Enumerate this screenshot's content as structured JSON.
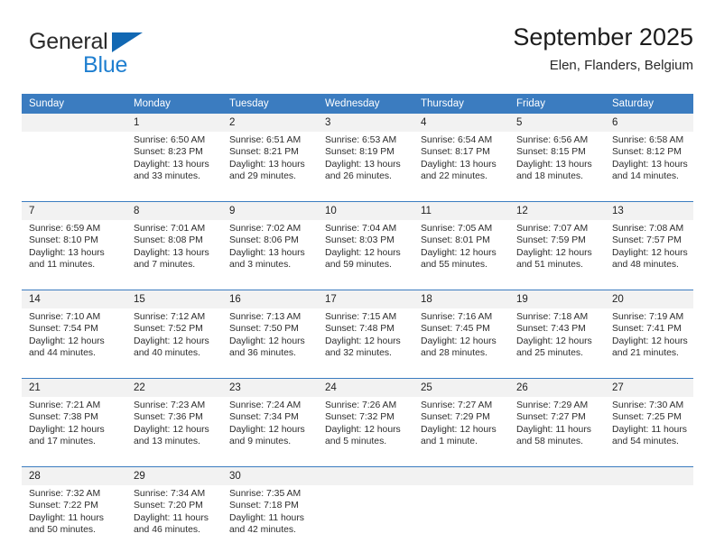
{
  "logo": {
    "word1": "General",
    "word2": "Blue",
    "triangle_color": "#1268b3",
    "blue_text_color": "#1f7fd0"
  },
  "header": {
    "title": "September 2025",
    "subtitle": "Elen, Flanders, Belgium",
    "header_bg": "#3b7cc0",
    "daynum_bg": "#f2f2f2"
  },
  "weekday_headers": [
    "Sunday",
    "Monday",
    "Tuesday",
    "Wednesday",
    "Thursday",
    "Friday",
    "Saturday"
  ],
  "weeks": [
    {
      "days": [
        {
          "num": "",
          "sunrise": "",
          "sunset": "",
          "daylight1": "",
          "daylight2": ""
        },
        {
          "num": "1",
          "sunrise": "Sunrise: 6:50 AM",
          "sunset": "Sunset: 8:23 PM",
          "daylight1": "Daylight: 13 hours",
          "daylight2": "and 33 minutes."
        },
        {
          "num": "2",
          "sunrise": "Sunrise: 6:51 AM",
          "sunset": "Sunset: 8:21 PM",
          "daylight1": "Daylight: 13 hours",
          "daylight2": "and 29 minutes."
        },
        {
          "num": "3",
          "sunrise": "Sunrise: 6:53 AM",
          "sunset": "Sunset: 8:19 PM",
          "daylight1": "Daylight: 13 hours",
          "daylight2": "and 26 minutes."
        },
        {
          "num": "4",
          "sunrise": "Sunrise: 6:54 AM",
          "sunset": "Sunset: 8:17 PM",
          "daylight1": "Daylight: 13 hours",
          "daylight2": "and 22 minutes."
        },
        {
          "num": "5",
          "sunrise": "Sunrise: 6:56 AM",
          "sunset": "Sunset: 8:15 PM",
          "daylight1": "Daylight: 13 hours",
          "daylight2": "and 18 minutes."
        },
        {
          "num": "6",
          "sunrise": "Sunrise: 6:58 AM",
          "sunset": "Sunset: 8:12 PM",
          "daylight1": "Daylight: 13 hours",
          "daylight2": "and 14 minutes."
        }
      ]
    },
    {
      "days": [
        {
          "num": "7",
          "sunrise": "Sunrise: 6:59 AM",
          "sunset": "Sunset: 8:10 PM",
          "daylight1": "Daylight: 13 hours",
          "daylight2": "and 11 minutes."
        },
        {
          "num": "8",
          "sunrise": "Sunrise: 7:01 AM",
          "sunset": "Sunset: 8:08 PM",
          "daylight1": "Daylight: 13 hours",
          "daylight2": "and 7 minutes."
        },
        {
          "num": "9",
          "sunrise": "Sunrise: 7:02 AM",
          "sunset": "Sunset: 8:06 PM",
          "daylight1": "Daylight: 13 hours",
          "daylight2": "and 3 minutes."
        },
        {
          "num": "10",
          "sunrise": "Sunrise: 7:04 AM",
          "sunset": "Sunset: 8:03 PM",
          "daylight1": "Daylight: 12 hours",
          "daylight2": "and 59 minutes."
        },
        {
          "num": "11",
          "sunrise": "Sunrise: 7:05 AM",
          "sunset": "Sunset: 8:01 PM",
          "daylight1": "Daylight: 12 hours",
          "daylight2": "and 55 minutes."
        },
        {
          "num": "12",
          "sunrise": "Sunrise: 7:07 AM",
          "sunset": "Sunset: 7:59 PM",
          "daylight1": "Daylight: 12 hours",
          "daylight2": "and 51 minutes."
        },
        {
          "num": "13",
          "sunrise": "Sunrise: 7:08 AM",
          "sunset": "Sunset: 7:57 PM",
          "daylight1": "Daylight: 12 hours",
          "daylight2": "and 48 minutes."
        }
      ]
    },
    {
      "days": [
        {
          "num": "14",
          "sunrise": "Sunrise: 7:10 AM",
          "sunset": "Sunset: 7:54 PM",
          "daylight1": "Daylight: 12 hours",
          "daylight2": "and 44 minutes."
        },
        {
          "num": "15",
          "sunrise": "Sunrise: 7:12 AM",
          "sunset": "Sunset: 7:52 PM",
          "daylight1": "Daylight: 12 hours",
          "daylight2": "and 40 minutes."
        },
        {
          "num": "16",
          "sunrise": "Sunrise: 7:13 AM",
          "sunset": "Sunset: 7:50 PM",
          "daylight1": "Daylight: 12 hours",
          "daylight2": "and 36 minutes."
        },
        {
          "num": "17",
          "sunrise": "Sunrise: 7:15 AM",
          "sunset": "Sunset: 7:48 PM",
          "daylight1": "Daylight: 12 hours",
          "daylight2": "and 32 minutes."
        },
        {
          "num": "18",
          "sunrise": "Sunrise: 7:16 AM",
          "sunset": "Sunset: 7:45 PM",
          "daylight1": "Daylight: 12 hours",
          "daylight2": "and 28 minutes."
        },
        {
          "num": "19",
          "sunrise": "Sunrise: 7:18 AM",
          "sunset": "Sunset: 7:43 PM",
          "daylight1": "Daylight: 12 hours",
          "daylight2": "and 25 minutes."
        },
        {
          "num": "20",
          "sunrise": "Sunrise: 7:19 AM",
          "sunset": "Sunset: 7:41 PM",
          "daylight1": "Daylight: 12 hours",
          "daylight2": "and 21 minutes."
        }
      ]
    },
    {
      "days": [
        {
          "num": "21",
          "sunrise": "Sunrise: 7:21 AM",
          "sunset": "Sunset: 7:38 PM",
          "daylight1": "Daylight: 12 hours",
          "daylight2": "and 17 minutes."
        },
        {
          "num": "22",
          "sunrise": "Sunrise: 7:23 AM",
          "sunset": "Sunset: 7:36 PM",
          "daylight1": "Daylight: 12 hours",
          "daylight2": "and 13 minutes."
        },
        {
          "num": "23",
          "sunrise": "Sunrise: 7:24 AM",
          "sunset": "Sunset: 7:34 PM",
          "daylight1": "Daylight: 12 hours",
          "daylight2": "and 9 minutes."
        },
        {
          "num": "24",
          "sunrise": "Sunrise: 7:26 AM",
          "sunset": "Sunset: 7:32 PM",
          "daylight1": "Daylight: 12 hours",
          "daylight2": "and 5 minutes."
        },
        {
          "num": "25",
          "sunrise": "Sunrise: 7:27 AM",
          "sunset": "Sunset: 7:29 PM",
          "daylight1": "Daylight: 12 hours",
          "daylight2": "and 1 minute."
        },
        {
          "num": "26",
          "sunrise": "Sunrise: 7:29 AM",
          "sunset": "Sunset: 7:27 PM",
          "daylight1": "Daylight: 11 hours",
          "daylight2": "and 58 minutes."
        },
        {
          "num": "27",
          "sunrise": "Sunrise: 7:30 AM",
          "sunset": "Sunset: 7:25 PM",
          "daylight1": "Daylight: 11 hours",
          "daylight2": "and 54 minutes."
        }
      ]
    },
    {
      "days": [
        {
          "num": "28",
          "sunrise": "Sunrise: 7:32 AM",
          "sunset": "Sunset: 7:22 PM",
          "daylight1": "Daylight: 11 hours",
          "daylight2": "and 50 minutes."
        },
        {
          "num": "29",
          "sunrise": "Sunrise: 7:34 AM",
          "sunset": "Sunset: 7:20 PM",
          "daylight1": "Daylight: 11 hours",
          "daylight2": "and 46 minutes."
        },
        {
          "num": "30",
          "sunrise": "Sunrise: 7:35 AM",
          "sunset": "Sunset: 7:18 PM",
          "daylight1": "Daylight: 11 hours",
          "daylight2": "and 42 minutes."
        },
        {
          "num": "",
          "sunrise": "",
          "sunset": "",
          "daylight1": "",
          "daylight2": ""
        },
        {
          "num": "",
          "sunrise": "",
          "sunset": "",
          "daylight1": "",
          "daylight2": ""
        },
        {
          "num": "",
          "sunrise": "",
          "sunset": "",
          "daylight1": "",
          "daylight2": ""
        },
        {
          "num": "",
          "sunrise": "",
          "sunset": "",
          "daylight1": "",
          "daylight2": ""
        }
      ]
    }
  ]
}
